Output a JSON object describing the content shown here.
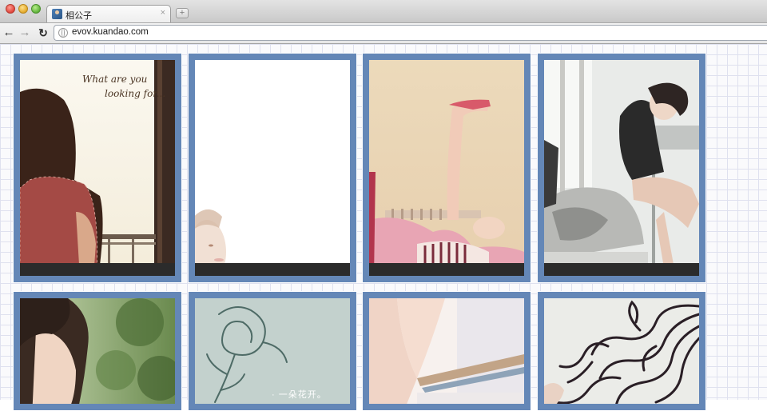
{
  "browser": {
    "tab_title": "相公子",
    "tab_close": "×",
    "new_tab": "+",
    "url": "evov.kuandao.com",
    "back_icon": "arrow-left-icon",
    "forward_icon": "arrow-right-icon",
    "reload_icon": "reload-icon"
  },
  "photos": [
    {
      "id": "girl-window",
      "quote_line1": "What are you",
      "quote_line2": "looking for..."
    },
    {
      "id": "blank-faded"
    },
    {
      "id": "legs-up"
    },
    {
      "id": "girl-desk"
    },
    {
      "id": "girl-hair-green"
    },
    {
      "id": "flower-sketch",
      "text": "· 一朵花开。"
    },
    {
      "id": "arm-light"
    },
    {
      "id": "curly-hair"
    }
  ],
  "colors": {
    "frame": "#6487b7",
    "caption_bar": "#2b2b2b",
    "grid_line": "#dfe1ef"
  }
}
